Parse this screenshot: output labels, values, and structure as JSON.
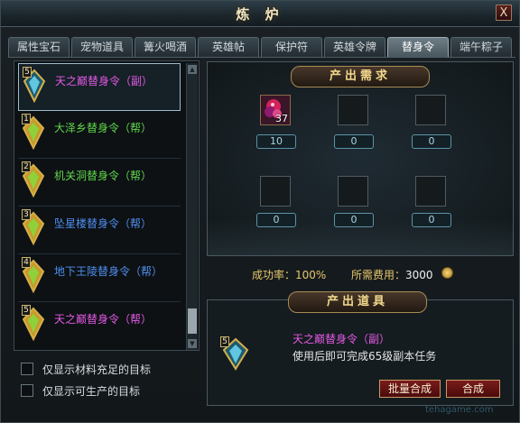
{
  "window": {
    "title": "炼 炉",
    "close_label": "X"
  },
  "tabs": [
    {
      "label": "属性宝石",
      "active": false
    },
    {
      "label": "宠物道具",
      "active": false
    },
    {
      "label": "篝火喝酒",
      "active": false
    },
    {
      "label": "英雄帖",
      "active": false
    },
    {
      "label": "保护符",
      "active": false
    },
    {
      "label": "英雄令牌",
      "active": false
    },
    {
      "label": "替身令",
      "active": true
    },
    {
      "label": "端午粽子",
      "active": false
    }
  ],
  "recipe_list": {
    "items": [
      {
        "level": "5",
        "name": "天之巅替身令（副）",
        "color": "#e459e4",
        "gem": "blue",
        "selected": true
      },
      {
        "level": "1",
        "name": "大泽乡替身令（帮）",
        "color": "#5fd84a",
        "gem": "green",
        "selected": false
      },
      {
        "level": "2",
        "name": "机关洞替身令（帮）",
        "color": "#5fd84a",
        "gem": "green",
        "selected": false
      },
      {
        "level": "3",
        "name": "坠星楼替身令（帮）",
        "color": "#4f8ff0",
        "gem": "green",
        "selected": false
      },
      {
        "level": "4",
        "name": "地下王陵替身令（帮）",
        "color": "#4f8ff0",
        "gem": "green",
        "selected": false
      },
      {
        "level": "5",
        "name": "天之巅替身令（帮）",
        "color": "#e459e4",
        "gem": "green",
        "selected": false
      }
    ]
  },
  "filters": {
    "sufficient_label": "仅显示材料充足的目标",
    "producible_label": "仅显示可生产的目标"
  },
  "requirements": {
    "header": "产出需求",
    "slots": [
      {
        "filled": true,
        "stack": "37",
        "qty": "10"
      },
      {
        "filled": false,
        "stack": "",
        "qty": "0"
      },
      {
        "filled": false,
        "stack": "",
        "qty": "0"
      },
      {
        "filled": false,
        "stack": "",
        "qty": "0"
      },
      {
        "filled": false,
        "stack": "",
        "qty": "0"
      },
      {
        "filled": false,
        "stack": "",
        "qty": "0"
      }
    ]
  },
  "stats": {
    "success_rate_label": "成功率：",
    "success_rate_value": "100%",
    "cost_label": "所需费用：",
    "cost_value": "3000"
  },
  "output": {
    "header": "产出道具",
    "item_level": "5",
    "item_name": "天之巅替身令（副）",
    "item_desc": "使用后即可完成65级副本任务"
  },
  "buttons": {
    "batch_label": "批量合成",
    "craft_label": "合成"
  },
  "watermark": "tehagame.com"
}
